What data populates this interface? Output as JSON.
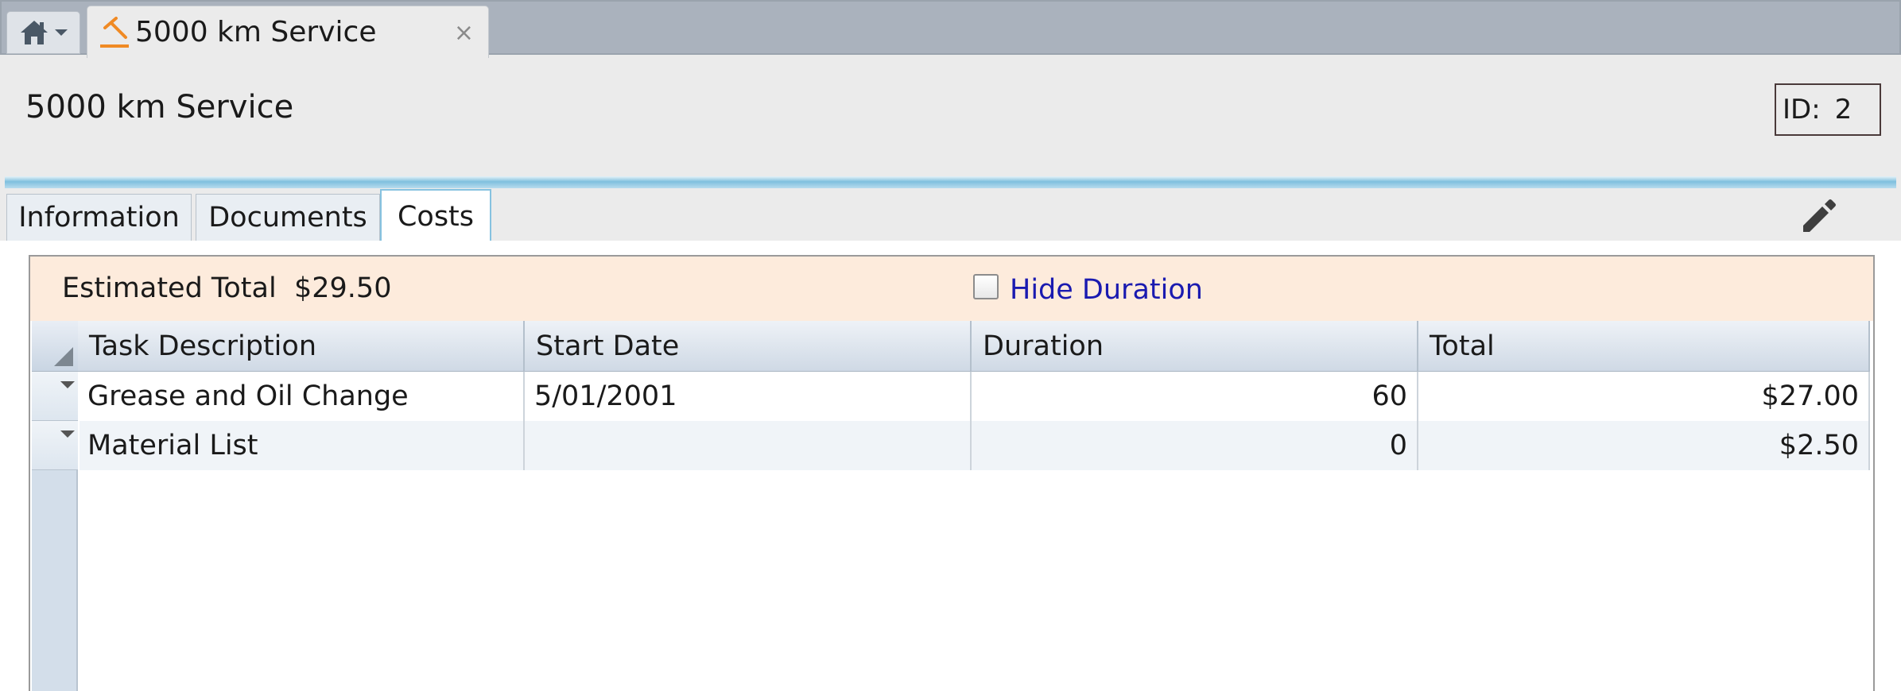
{
  "window": {
    "home_tab_icon": "home-icon",
    "doc_tab": {
      "icon": "hammer-icon",
      "title": "5000 km Service",
      "close": "×"
    }
  },
  "header": {
    "title": "5000 km Service",
    "id_label": "ID:",
    "id_value": "2"
  },
  "tabs": [
    {
      "label": "Information",
      "active": false
    },
    {
      "label": "Documents",
      "active": false
    },
    {
      "label": "Costs",
      "active": true
    }
  ],
  "toolbar": {
    "edit_icon": "pencil-icon"
  },
  "summary": {
    "estimated_total_label": "Estimated Total",
    "estimated_total_value": "$29.50",
    "hide_duration_label": "Hide Duration",
    "hide_duration_checked": false
  },
  "table": {
    "columns": [
      "Task Description",
      "Start Date",
      "Duration",
      "Total"
    ],
    "rows": [
      {
        "task": "Grease and Oil Change",
        "start": "5/01/2001",
        "duration": "60",
        "total": "$27.00"
      },
      {
        "task": "Material List",
        "start": "",
        "duration": "0",
        "total": "$2.50"
      }
    ]
  },
  "colors": {
    "accent": "#7fc0de",
    "summary_bg": "#fdebdc",
    "link": "#1a1ab0",
    "brand_orange": "#f08a24"
  }
}
